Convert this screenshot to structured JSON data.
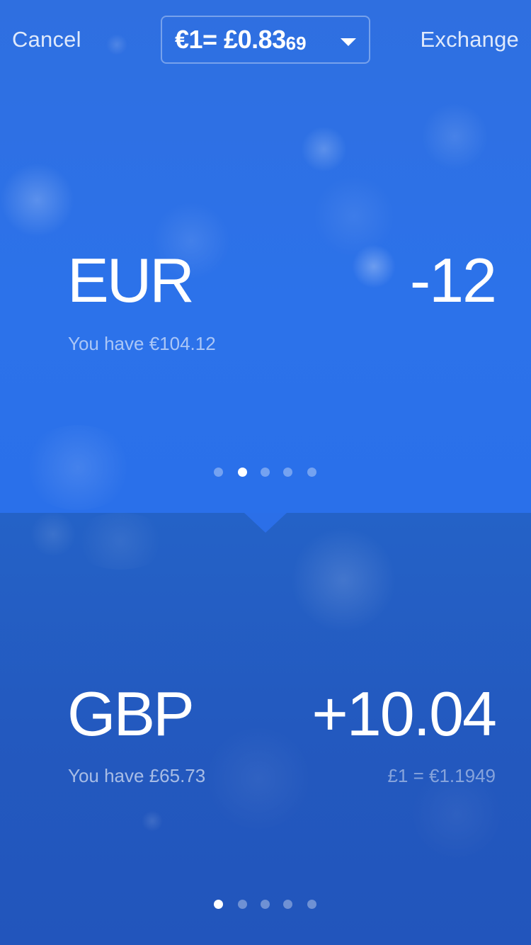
{
  "nav": {
    "cancel_label": "Cancel",
    "exchange_label": "Exchange"
  },
  "rate_selector": {
    "main": "€1= £0.83",
    "small_digits": "69",
    "caret_icon": "caret-down-icon"
  },
  "from_account": {
    "currency": "EUR",
    "amount": "-12",
    "balance": "You have €104.12",
    "page_count": 5,
    "active_page_index": 1
  },
  "to_account": {
    "currency": "GBP",
    "amount": "+10.04",
    "balance": "You have £65.73",
    "rate": "£1 = €1.1949",
    "page_count": 5,
    "active_page_index": 0
  },
  "colors": {
    "top_background": "#2c72ea",
    "bottom_background": "#2359bf",
    "text": "#ffffff"
  }
}
